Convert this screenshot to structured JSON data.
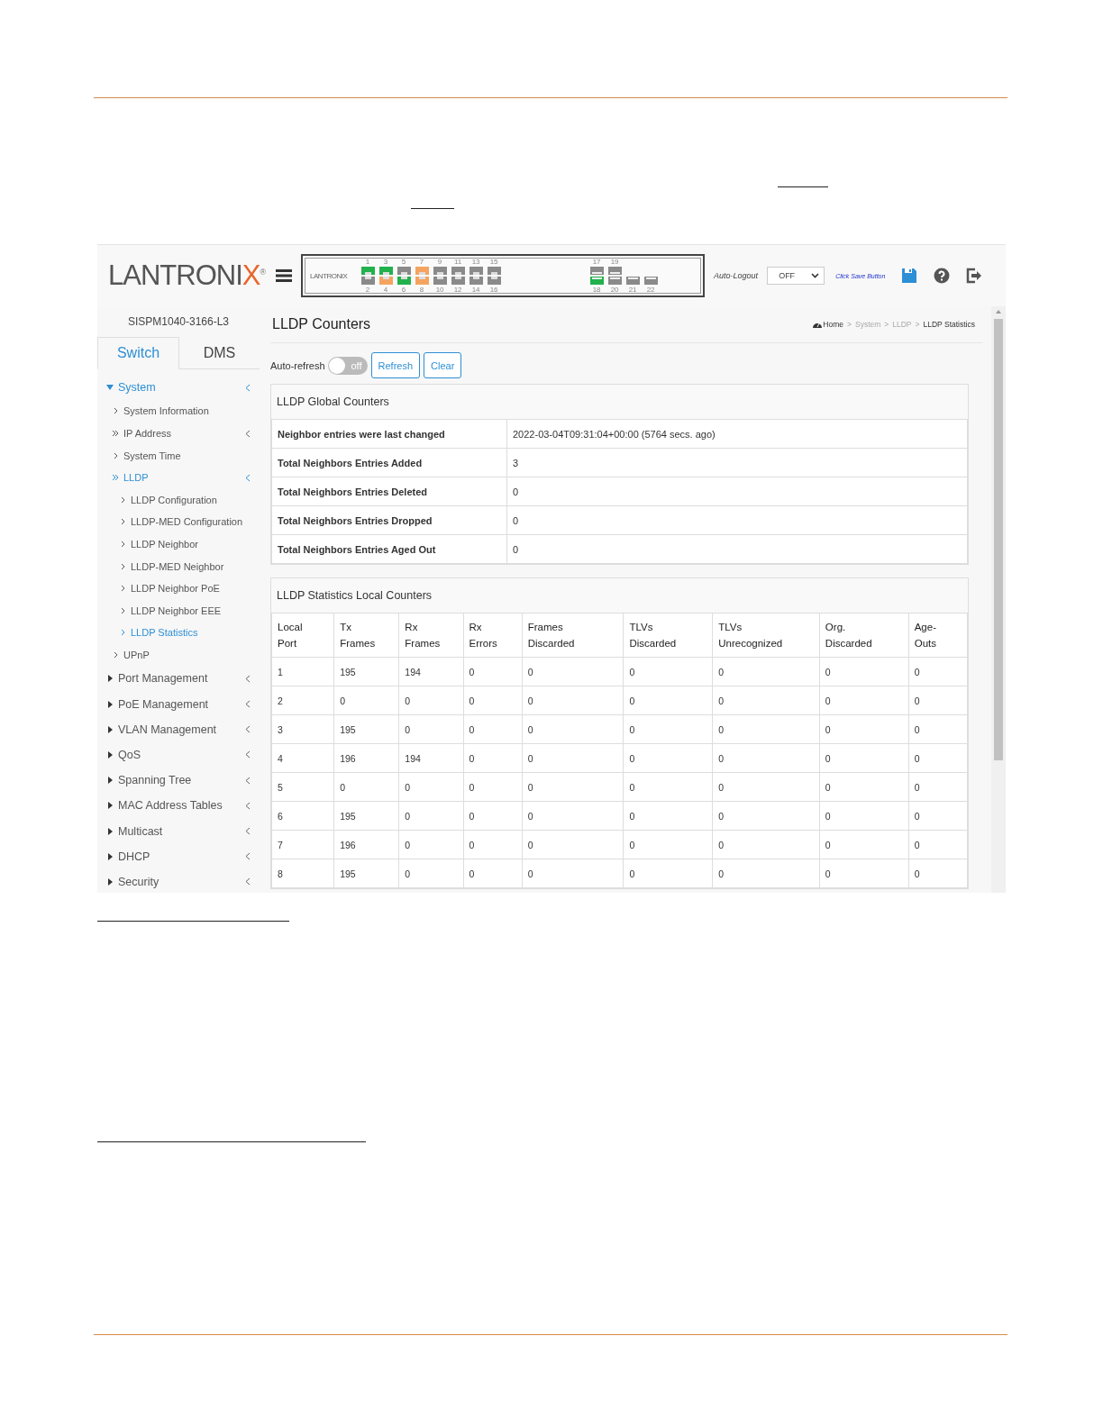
{
  "header": {
    "logo": {
      "text": "LANTRONI",
      "accent": "X",
      "mark": "®"
    },
    "switch_panel": {
      "brand": "LANTRONIX",
      "ports": [
        {
          "top": {
            "number": "1",
            "color": "#22b14c"
          },
          "bottom": {
            "number": "2",
            "color": "#8a8a8a"
          }
        },
        {
          "top": {
            "number": "3",
            "color": "#22b14c"
          },
          "bottom": {
            "number": "4",
            "color": "#f4a460"
          }
        },
        {
          "top": {
            "number": "5",
            "color": "#8a8a8a"
          },
          "bottom": {
            "number": "6",
            "color": "#22b14c"
          }
        },
        {
          "top": {
            "number": "7",
            "color": "#f4a460"
          },
          "bottom": {
            "number": "8",
            "color": "#f4a460"
          }
        },
        {
          "top": {
            "number": "9",
            "color": "#8a8a8a"
          },
          "bottom": {
            "number": "10",
            "color": "#8a8a8a"
          }
        },
        {
          "top": {
            "number": "11",
            "color": "#8a8a8a"
          },
          "bottom": {
            "number": "12",
            "color": "#8a8a8a"
          }
        },
        {
          "top": {
            "number": "13",
            "color": "#8a8a8a"
          },
          "bottom": {
            "number": "14",
            "color": "#8a8a8a"
          }
        },
        {
          "top": {
            "number": "15",
            "color": "#8a8a8a"
          },
          "bottom": {
            "number": "16",
            "color": "#8a8a8a"
          }
        }
      ],
      "sfp_ports": [
        {
          "top": {
            "number": "17",
            "color": "#8a8a8a"
          },
          "bottom": {
            "number": "18",
            "color": "#22b14c"
          }
        },
        {
          "top": {
            "number": "19",
            "color": "#8a8a8a"
          },
          "bottom": {
            "number": "20",
            "color": "#8a8a8a"
          }
        },
        {
          "bottom": {
            "number": "21",
            "color": "#8a8a8a"
          }
        },
        {
          "bottom": {
            "number": "22",
            "color": "#8a8a8a"
          }
        }
      ]
    },
    "auto_logout": {
      "label": "Auto-Logout",
      "value": "OFF"
    },
    "save_hint": "Click Save Button"
  },
  "sidebar": {
    "model": "SISPM1040-3166-L3",
    "tabs": [
      {
        "label": "Switch",
        "selected": true
      },
      {
        "label": "DMS",
        "selected": false
      }
    ],
    "menu": [
      {
        "label": "System",
        "expanded": true,
        "selected": true,
        "children": [
          {
            "label": "System Information",
            "selected": false
          },
          {
            "label": "IP Address",
            "expanded": false,
            "selected": false
          },
          {
            "label": "System Time",
            "selected": false
          },
          {
            "label": "LLDP",
            "expanded": true,
            "selected": true,
            "children": [
              {
                "label": "LLDP Configuration",
                "selected": false
              },
              {
                "label": "LLDP-MED Configuration",
                "selected": false
              },
              {
                "label": "LLDP Neighbor",
                "selected": false
              },
              {
                "label": "LLDP-MED Neighbor",
                "selected": false
              },
              {
                "label": "LLDP Neighbor PoE",
                "selected": false
              },
              {
                "label": "LLDP Neighbor EEE",
                "selected": false
              },
              {
                "label": "LLDP Statistics",
                "selected": true
              }
            ]
          },
          {
            "label": "UPnP",
            "selected": false
          }
        ]
      },
      {
        "label": "Port Management",
        "expanded": false,
        "selected": false
      },
      {
        "label": "PoE Management",
        "expanded": false,
        "selected": false
      },
      {
        "label": "VLAN Management",
        "expanded": false,
        "selected": false
      },
      {
        "label": "QoS",
        "expanded": false,
        "selected": false
      },
      {
        "label": "Spanning Tree",
        "expanded": false,
        "selected": false
      },
      {
        "label": "MAC Address Tables",
        "expanded": false,
        "selected": false
      },
      {
        "label": "Multicast",
        "expanded": false,
        "selected": false
      },
      {
        "label": "DHCP",
        "expanded": false,
        "selected": false
      },
      {
        "label": "Security",
        "expanded": false,
        "selected": false
      }
    ]
  },
  "main": {
    "title": "LLDP Counters",
    "breadcrumb": {
      "items": [
        "Home",
        "System",
        "LLDP",
        "LLDP Statistics"
      ],
      "separator": ">"
    },
    "auto_refresh": {
      "label": "Auto-refresh",
      "on": false,
      "state_text": "off"
    },
    "buttons": [
      "Refresh",
      "Clear"
    ],
    "global_counters": {
      "title": "LLDP Global Counters",
      "rows": [
        {
          "label": "Neighbor entries were last changed",
          "value": "2022-03-04T09:31:04+00:00 (5764 secs. ago)"
        },
        {
          "label": "Total Neighbors Entries Added",
          "value": "3"
        },
        {
          "label": "Total Neighbors Entries Deleted",
          "value": "0"
        },
        {
          "label": "Total Neighbors Entries Dropped",
          "value": "0"
        },
        {
          "label": "Total Neighbors Entries Aged Out",
          "value": "0"
        }
      ]
    },
    "local_counters": {
      "title": "LLDP Statistics Local Counters",
      "columns": [
        "Local Port",
        "Tx Frames",
        "Rx Frames",
        "Rx Errors",
        "Frames Discarded",
        "TLVs Discarded",
        "TLVs Unrecognized",
        "Org. Discarded",
        "Age- Outs"
      ],
      "rows": [
        [
          "1",
          "195",
          "194",
          "0",
          "0",
          "0",
          "0",
          "0",
          "0"
        ],
        [
          "2",
          "0",
          "0",
          "0",
          "0",
          "0",
          "0",
          "0",
          "0"
        ],
        [
          "3",
          "195",
          "0",
          "0",
          "0",
          "0",
          "0",
          "0",
          "0"
        ],
        [
          "4",
          "196",
          "194",
          "0",
          "0",
          "0",
          "0",
          "0",
          "0"
        ],
        [
          "5",
          "0",
          "0",
          "0",
          "0",
          "0",
          "0",
          "0",
          "0"
        ],
        [
          "6",
          "195",
          "0",
          "0",
          "0",
          "0",
          "0",
          "0",
          "0"
        ],
        [
          "7",
          "196",
          "0",
          "0",
          "0",
          "0",
          "0",
          "0",
          "0"
        ],
        [
          "8",
          "195",
          "0",
          "0",
          "0",
          "0",
          "0",
          "0",
          "0"
        ]
      ]
    }
  }
}
